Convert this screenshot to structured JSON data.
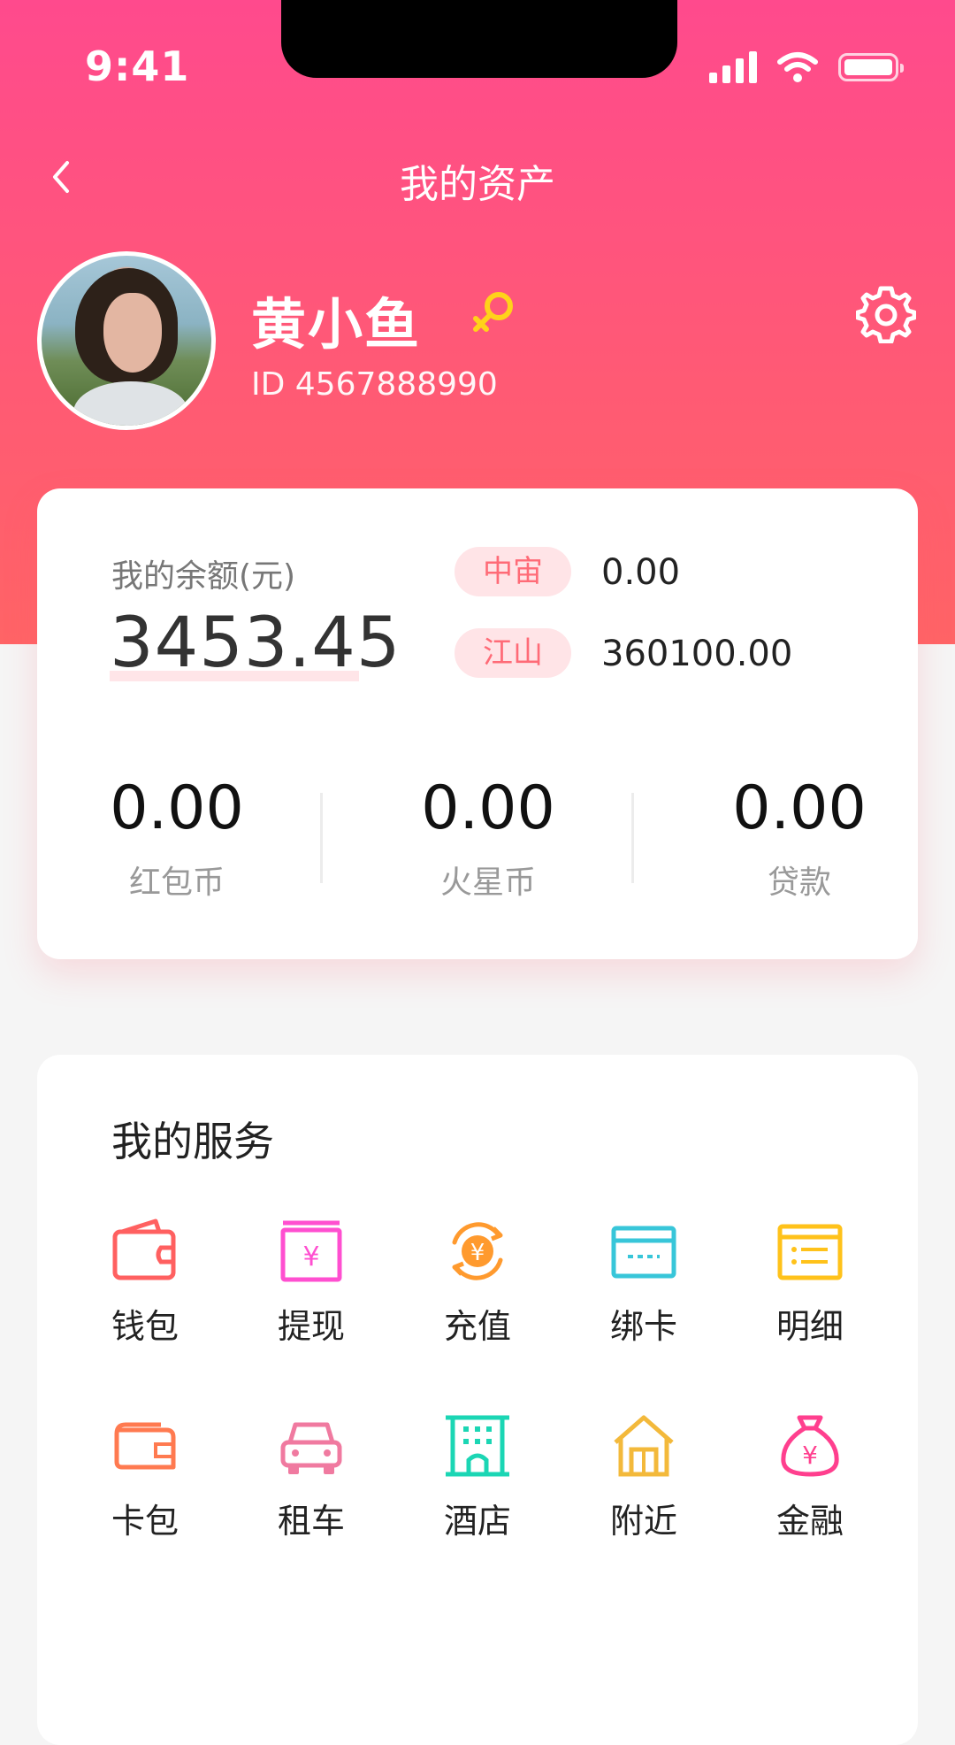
{
  "status_bar": {
    "time": "9:41"
  },
  "nav": {
    "title": "我的资产"
  },
  "user": {
    "name": "黄小鱼",
    "id": "ID 4567888990"
  },
  "balance": {
    "label": "我的余额(元)",
    "value": "3453.45",
    "tags": [
      {
        "label": "中宙",
        "value": "0.00"
      },
      {
        "label": "江山",
        "value": "360100.00"
      }
    ],
    "stats": [
      {
        "value": "0.00",
        "label": "红包币"
      },
      {
        "value": "0.00",
        "label": "火星币"
      },
      {
        "value": "0.00",
        "label": "贷款"
      }
    ]
  },
  "services": {
    "title": "我的服务",
    "items": [
      {
        "label": "钱包",
        "icon": "wallet-icon",
        "color": "#ff6060"
      },
      {
        "label": "提现",
        "icon": "withdraw-icon",
        "color": "#ff4fd0"
      },
      {
        "label": "充值",
        "icon": "recharge-icon",
        "color": "#ff9a2e"
      },
      {
        "label": "绑卡",
        "icon": "bind-card-icon",
        "color": "#38c6d9"
      },
      {
        "label": "明细",
        "icon": "details-icon",
        "color": "#ffc21a"
      },
      {
        "label": "卡包",
        "icon": "card-wallet-icon",
        "color": "#ff7a50"
      },
      {
        "label": "租车",
        "icon": "car-icon",
        "color": "#f07aa0"
      },
      {
        "label": "酒店",
        "icon": "hotel-icon",
        "color": "#1bd6b4"
      },
      {
        "label": "附近",
        "icon": "nearby-icon",
        "color": "#f3b93b"
      },
      {
        "label": "金融",
        "icon": "finance-icon",
        "color": "#ff3f8e"
      }
    ]
  },
  "colors": {
    "header_top": "#ff4a8d",
    "header_bottom": "#ff6466",
    "tag_bg": "#ffe4e7",
    "tag_text": "#ff6b77"
  }
}
